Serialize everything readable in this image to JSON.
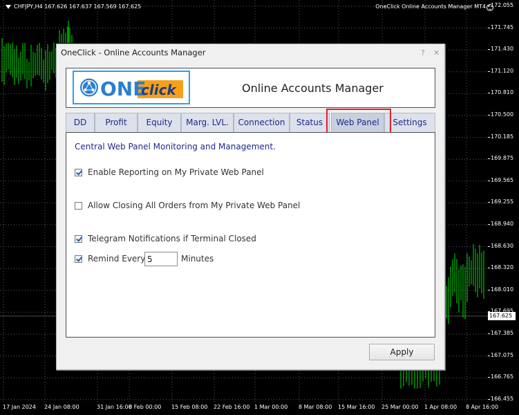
{
  "chart": {
    "symbol_line": "CHFJPY,H4  167.626 167.637 167.569 167.625",
    "ea_title": "OneClick Online Accounts Manager MT4",
    "current_price": "167.625",
    "price_ticks": [
      "172.055",
      "171.745",
      "171.430",
      "171.120",
      "170.810",
      "170.500",
      "170.185",
      "169.875",
      "169.565",
      "169.255",
      "168.940",
      "168.630",
      "168.320",
      "168.010",
      "167.695",
      "167.385",
      "167.075",
      "166.765",
      "166.455"
    ],
    "time_ticks": [
      "17 Jan 2024",
      "24 Jan 08:00",
      "31 Jan 16:00",
      "8 Feb 00:00",
      "15 Feb 08:00",
      "22 Feb 16:00",
      "1 Mar 00:00",
      "8 Mar 08:00",
      "15 Mar 16:00",
      "25 Mar 00:00",
      "1 Apr 08:00",
      "8 Apr 16:00"
    ],
    "colors": {
      "candles": "#00e000",
      "grid": "#5a5a7a",
      "background": "#000000"
    }
  },
  "dialog": {
    "title": "OneClick - Online Accounts Manager",
    "help_glyph": "?",
    "close_glyph": "✕",
    "logo_text": {
      "one": "ONE",
      "click": "click"
    },
    "app_title": "Online Accounts Manager",
    "tabs": [
      "DD",
      "Profit",
      "Equity",
      "Marg. LVL.",
      "Connection",
      "Status",
      "Web Panel",
      "Settings"
    ],
    "active_tab": "Web Panel",
    "panel": {
      "heading": "Central Web Panel Monitoring and Management.",
      "enable_reporting": {
        "label": "Enable Reporting on My Private Web Panel",
        "checked": true
      },
      "allow_closing": {
        "label": "Allow Closing All Orders from My Private Web Panel",
        "checked": false
      },
      "telegram": {
        "label": "Telegram Notifications if Terminal Closed",
        "checked": true
      },
      "remind": {
        "label": "Remind Every",
        "value": "5",
        "unit": "Minutes",
        "checked": true
      }
    },
    "apply_label": "Apply",
    "colors": {
      "accent": "#1d2a8a",
      "highlight": "#e0202a",
      "logo_blue": "#2aa0ea",
      "logo_orange": "#f5a11a"
    }
  }
}
